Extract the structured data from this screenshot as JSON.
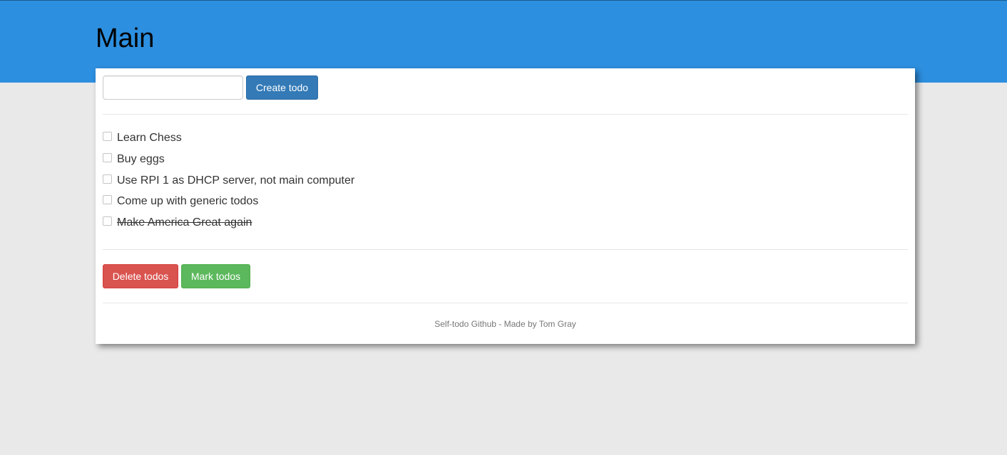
{
  "header": {
    "title": "Main"
  },
  "form": {
    "input_value": "",
    "create_label": "Create todo"
  },
  "todos": [
    {
      "label": "Learn Chess",
      "done": false
    },
    {
      "label": "Buy eggs",
      "done": false
    },
    {
      "label": "Use RPI 1 as DHCP server, not main computer",
      "done": false
    },
    {
      "label": "Come up with generic todos",
      "done": false
    },
    {
      "label": "Make America Great again",
      "done": true
    }
  ],
  "actions": {
    "delete_label": "Delete todos",
    "mark_label": "Mark todos"
  },
  "footer": {
    "link_text": "Self-todo Github",
    "separator": " - ",
    "credit": "Made by Tom Gray"
  },
  "colors": {
    "header_bg": "#2d8fdf",
    "primary": "#337ab7",
    "danger": "#d9534f",
    "success": "#5cb85c",
    "page_bg": "#e9e9e9"
  }
}
